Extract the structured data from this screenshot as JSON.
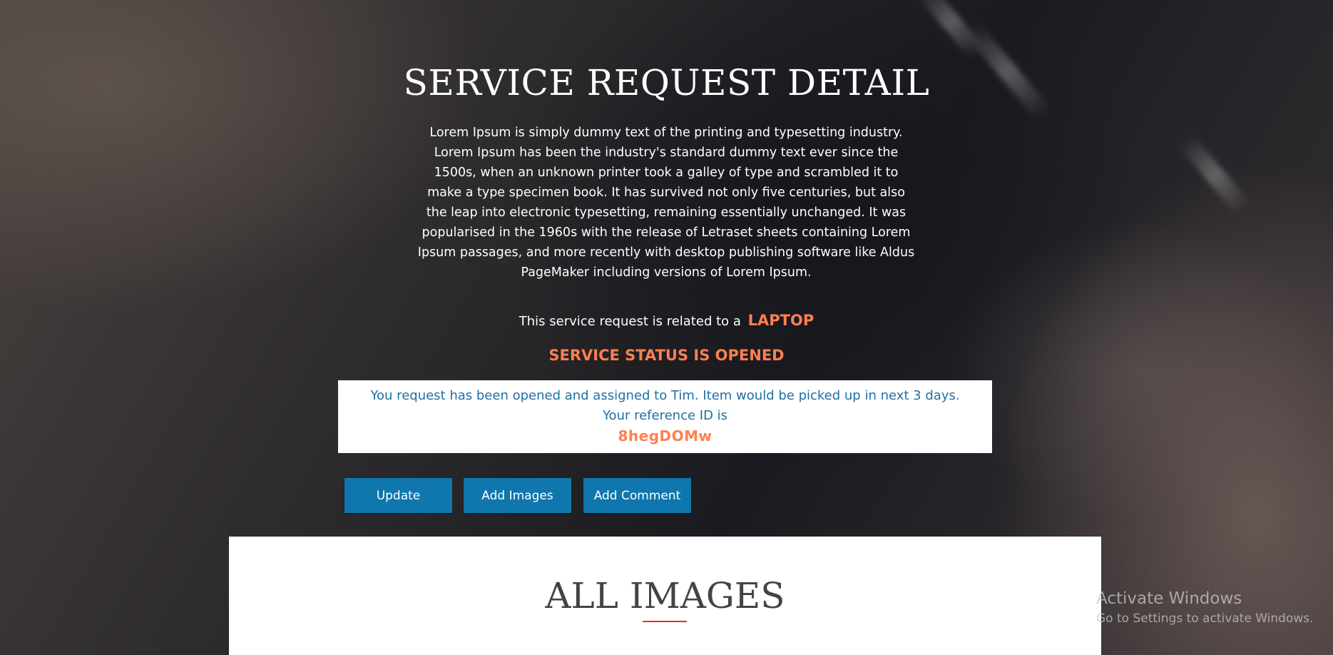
{
  "page": {
    "title": "SERVICE REQUEST DETAIL",
    "intro": "Lorem Ipsum is simply dummy text of the printing and typesetting industry. Lorem Ipsum has been the industry's standard dummy text ever since the 1500s, when an unknown printer took a galley of type and scrambled it to make a type specimen book. It has survived not only five centuries, but also the leap into electronic typesetting, remaining essentially unchanged. It was popularised in the 1960s with the release of Letraset sheets containing Lorem Ipsum passages, and more recently with desktop publishing software like Aldus PageMaker including versions of Lorem Ipsum."
  },
  "request": {
    "related_prefix": "This service request is related to a",
    "device": "LAPTOP",
    "status": "SERVICE STATUS IS OPENED"
  },
  "notice": {
    "message": "You request has been opened and assigned to Tim. Item would be picked up in next 3 days.",
    "reference_label": "Your reference ID is",
    "reference_id": "8hegDOMw"
  },
  "actions": {
    "update_label": "Update",
    "add_images_label": "Add Images",
    "add_comment_label": "Add Comment"
  },
  "images_section": {
    "title": "ALL IMAGES"
  },
  "watermark": {
    "title": "Activate Windows",
    "subtitle": "Go to Settings to activate Windows."
  },
  "colors": {
    "accent": "#ff7f50",
    "button": "#0f77ad",
    "notice_text": "#1f6fa3",
    "underline": "#e0302a"
  }
}
